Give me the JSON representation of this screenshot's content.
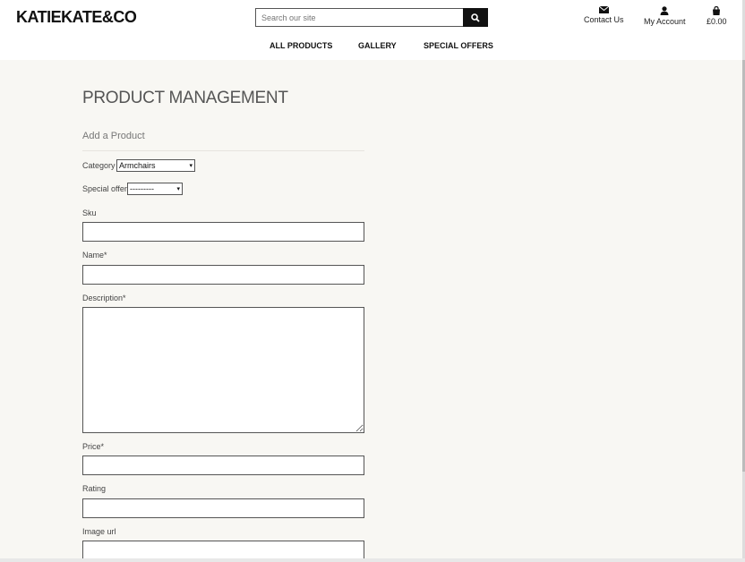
{
  "brand": {
    "logo": "KATIEKATE&CO"
  },
  "search": {
    "placeholder": "Search our site",
    "icon": "search-icon"
  },
  "nav": {
    "items": [
      {
        "label": "ALL PRODUCTS"
      },
      {
        "label": "GALLERY"
      },
      {
        "label": "SPECIAL OFFERS"
      }
    ]
  },
  "utility": {
    "contact": {
      "label": "Contact Us",
      "icon": "envelope-icon"
    },
    "account": {
      "label": "My Account",
      "icon": "user-icon"
    },
    "bag": {
      "label": "£0.00",
      "icon": "shopping-bag-icon"
    }
  },
  "page": {
    "title": "PRODUCT MANAGEMENT",
    "subtitle": "Add a Product"
  },
  "form": {
    "category": {
      "label": "Category",
      "value": "Armchairs"
    },
    "special_offer": {
      "label": "Special offer",
      "value": "---------"
    },
    "sku": {
      "label": "Sku",
      "value": ""
    },
    "name": {
      "label": "Name*",
      "value": ""
    },
    "description": {
      "label": "Description*",
      "value": ""
    },
    "price": {
      "label": "Price*",
      "value": ""
    },
    "rating": {
      "label": "Rating",
      "value": ""
    },
    "image_url": {
      "label": "Image url",
      "value": ""
    }
  },
  "colors": {
    "background": "#f8f7f3",
    "text": "#222222",
    "button": "#111111"
  }
}
